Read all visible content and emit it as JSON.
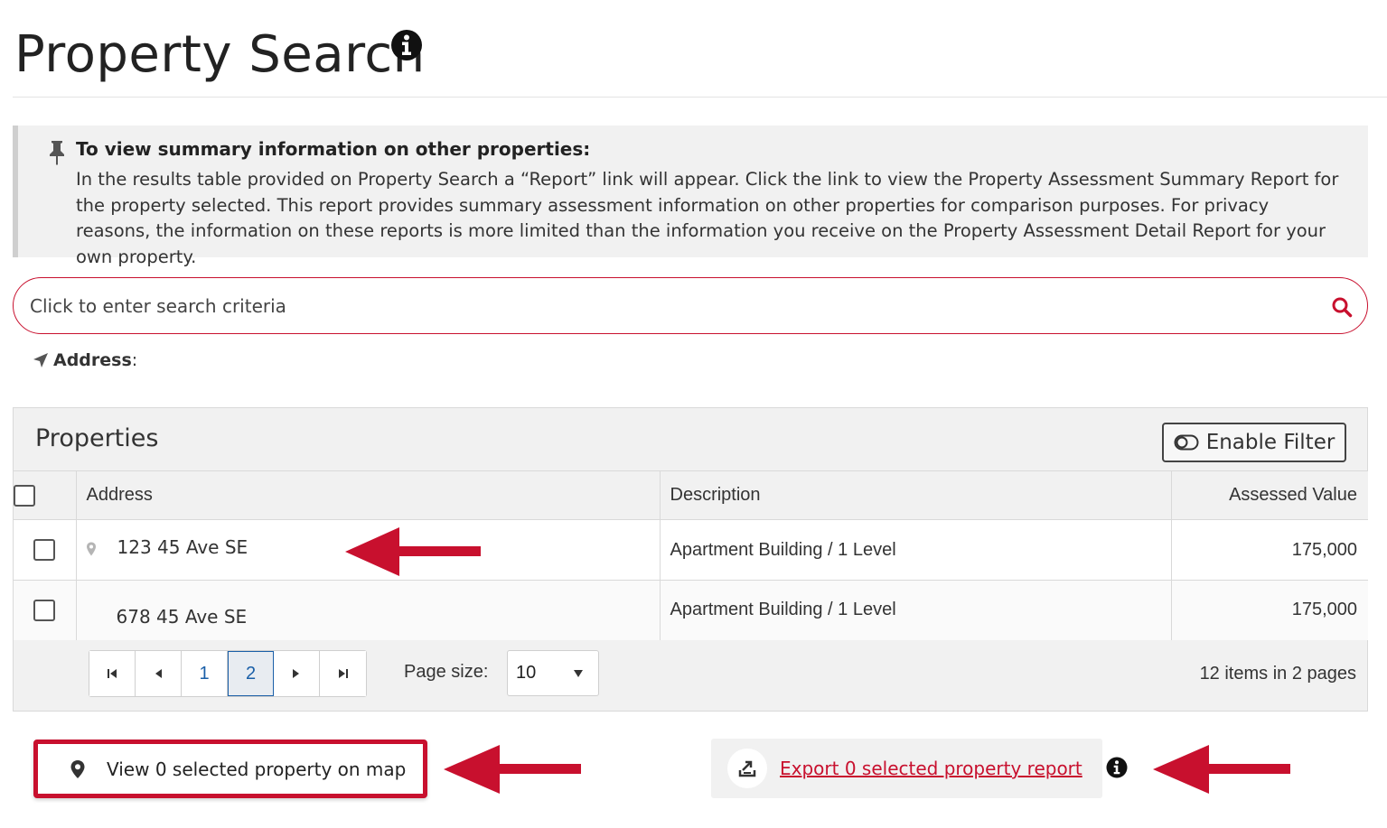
{
  "page": {
    "title": "Property Search",
    "title_info_icon": "info-circle-icon"
  },
  "notice": {
    "icon": "pushpin-icon",
    "heading": "To view summary information on other properties:",
    "body": "In the results table provided on Property Search a “Report” link will appear. Click the link to view the Property Assessment Summary Report for the property selected. This report provides summary assessment information on other properties for comparison purposes. For privacy reasons, the information on these reports is more limited than the information you receive on the Property Assessment Detail Report for your own property."
  },
  "search": {
    "placeholder": "Click to enter search criteria",
    "icon": "search-icon"
  },
  "address_line": {
    "icon": "location-arrow-icon",
    "label": "Address",
    "separator": ":"
  },
  "properties": {
    "title": "Properties",
    "filter_button": "Enable Filter",
    "columns": {
      "address": "Address",
      "description": "Description",
      "assessed_value": "Assessed Value"
    },
    "rows": [
      {
        "address": "123 45 Ave SE",
        "description": "Apartment Building / 1 Level",
        "assessed_value": "175,000",
        "has_map_pin": true
      },
      {
        "address": "678 45 Ave SE",
        "description": "Apartment Building / 1 Level",
        "assessed_value": "175,000",
        "has_map_pin": false
      }
    ],
    "pager": {
      "pages": [
        "1",
        "2"
      ],
      "current_page": "2",
      "page_size_label": "Page size:",
      "page_size": "10",
      "summary": "12 items in 2 pages"
    }
  },
  "actions": {
    "view_map": "View 0 selected property on map",
    "export_report": "Export 0 selected property report",
    "export_icon": "export-icon",
    "export_info_icon": "info-circle-icon"
  },
  "colors": {
    "accent": "#c8102e",
    "link_blue": "#1a5fa8",
    "panel_bg": "#f1f1f1",
    "text": "#222222"
  }
}
